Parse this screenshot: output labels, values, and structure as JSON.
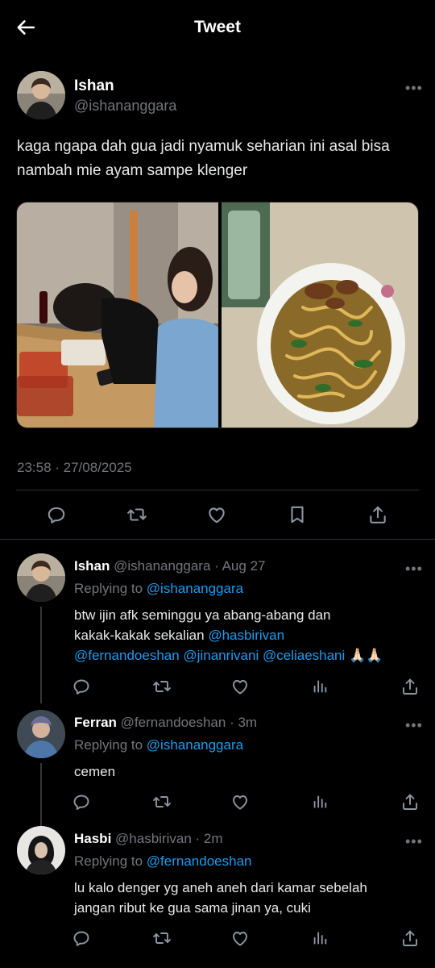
{
  "header": {
    "title": "Tweet"
  },
  "main": {
    "name": "Ishan",
    "handle": "@ishananggara",
    "text_line1": "kaga ngapa dah gua jadi nyamuk seharian ini asal bisa",
    "text_line2": "nambah mie ayam sampe klenger",
    "timestamp": "23:58 · 27/08/2025"
  },
  "replies": [
    {
      "name": "Ishan",
      "handle": "@ishananggara · Aug 27",
      "replying_to_label": "Replying to",
      "replying_to": "@ishananggara",
      "body_line1": "btw ijin afk seminggu ya abang-abang dan",
      "body_line2_text": "kakak-kakak sekalian",
      "body_line2_mention": "@hasbirivan",
      "body_line3_m1": "@fernandoeshan",
      "body_line3_m2": "@jinanrivani",
      "body_line3_m3": "@celiaeshani",
      "body_emoji": "🙏🏻🙏🏻"
    },
    {
      "name": "Ferran",
      "handle": "@fernandoeshan · 3m",
      "replying_to_label": "Replying to",
      "replying_to": "@ishananggara",
      "body_line1": "cemen"
    },
    {
      "name": "Hasbi",
      "handle": "@hasbirivan · 2m",
      "replying_to_label": "Replying to",
      "replying_to": "@fernandoeshan",
      "body_line1": "lu kalo denger yg aneh aneh dari kamar sebelah",
      "body_line2": "jangan ribut ke gua sama jinan ya, cuki"
    }
  ],
  "icons": {
    "back": "arrow-left-icon",
    "more": "more-horizontal-icon",
    "reply": "speech-bubble-icon",
    "retweet": "retweet-icon",
    "like": "heart-icon",
    "bookmark": "bookmark-icon",
    "share": "share-icon",
    "views": "bar-chart-icon"
  },
  "colors": {
    "background": "#000000",
    "text": "#e7e9ea",
    "secondary": "#71767b",
    "link": "#1d9bf0",
    "divider": "#2f3336"
  }
}
